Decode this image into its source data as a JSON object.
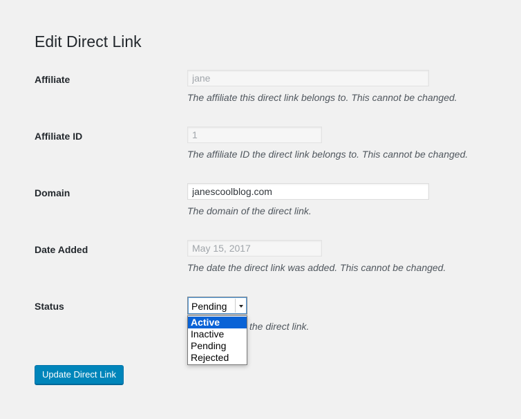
{
  "page": {
    "title": "Edit Direct Link"
  },
  "form": {
    "affiliate": {
      "label": "Affiliate",
      "value": "jane",
      "description": "The affiliate this direct link belongs to. This cannot be changed."
    },
    "affiliate_id": {
      "label": "Affiliate ID",
      "value": "1",
      "description": "The affiliate ID the direct link belongs to. This cannot be changed."
    },
    "domain": {
      "label": "Domain",
      "value": "janescoolblog.com",
      "description": "The domain of the direct link."
    },
    "date_added": {
      "label": "Date Added",
      "value": "May 15, 2017",
      "description": "The date the direct link was added. This cannot be changed."
    },
    "status": {
      "label": "Status",
      "value": "Pending",
      "options": [
        "Active",
        "Inactive",
        "Pending",
        "Rejected"
      ],
      "highlighted_option": "Active",
      "description_visible": "the direct link."
    }
  },
  "actions": {
    "submit_label": "Update Direct Link"
  },
  "colors": {
    "primary_button": "#0085ba",
    "dropdown_highlight": "#0a63d6",
    "background": "#f1f1f1"
  }
}
